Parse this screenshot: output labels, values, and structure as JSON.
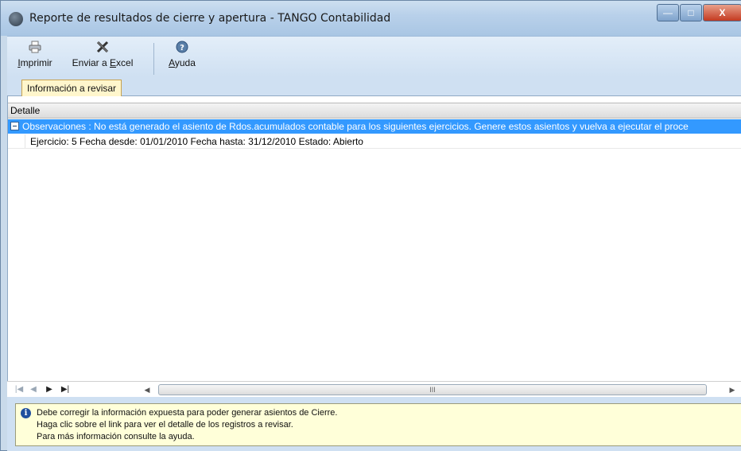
{
  "window": {
    "title": "Reporte de resultados de cierre y apertura - TANGO Contabilidad",
    "min_label": "—",
    "max_label": "□",
    "close_label": "X"
  },
  "toolbar": {
    "print_label_first": "I",
    "print_label_rest": "mprimir",
    "excel_label_prefix": "Enviar a ",
    "excel_label_accel": "E",
    "excel_label_rest": "xcel",
    "help_label_accel": "A",
    "help_label_rest": "yuda"
  },
  "tabs": [
    {
      "label": "Información a revisar",
      "selected": true
    }
  ],
  "grid": {
    "column_header": "Detalle",
    "group_row_text": "Observaciones : No está generado el asiento de Rdos.acumulados contable para los siguientes ejercicios. Genere estos asientos y vuelva a ejecutar el proce",
    "rows": [
      "Ejercicio: 5 Fecha desde: 01/01/2010 Fecha hasta: 31/12/2010 Estado: Abierto"
    ]
  },
  "navigator": {
    "first": "|◀",
    "prev": "◀",
    "next": "▶",
    "last": "▶|",
    "scroll_left": "◀",
    "scroll_grip": "III",
    "scroll_right": "▶"
  },
  "info": {
    "icon_glyph": "i",
    "lines": [
      "Debe corregir la información expuesta para poder generar asientos de Cierre.",
      "Haga clic sobre el link para ver el detalle de los registros a revisar.",
      "Para más información consulte la ayuda."
    ]
  },
  "colors": {
    "selection_blue": "#3399ff",
    "info_background": "#ffffd9",
    "tab_background": "#fff6cc"
  },
  "icons": [
    "app-logo-icon",
    "printer-icon",
    "excel-icon",
    "help-icon",
    "info-icon"
  ]
}
